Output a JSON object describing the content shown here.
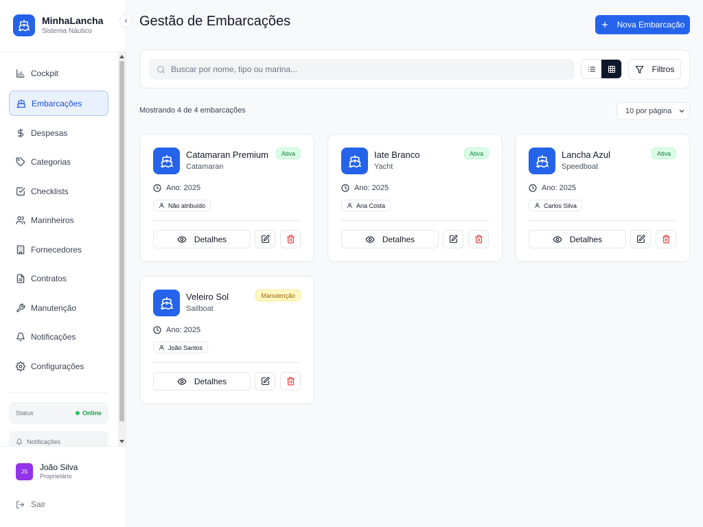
{
  "brand": {
    "name": "MinhaLancha",
    "subtitle": "Sistema Náutico"
  },
  "sidebar": {
    "items": [
      {
        "label": "Cockpit",
        "icon": "bar-chart-icon",
        "active": false
      },
      {
        "label": "Embarcações",
        "icon": "ship-icon",
        "active": true
      },
      {
        "label": "Despesas",
        "icon": "dollar-icon",
        "active": false
      },
      {
        "label": "Categorias",
        "icon": "tag-icon",
        "active": false
      },
      {
        "label": "Checklists",
        "icon": "checkbox-icon",
        "active": false
      },
      {
        "label": "Marinheiros",
        "icon": "users-icon",
        "active": false
      },
      {
        "label": "Fornecedores",
        "icon": "building-icon",
        "active": false
      },
      {
        "label": "Contratos",
        "icon": "file-icon",
        "active": false
      },
      {
        "label": "Manutenção",
        "icon": "wrench-icon",
        "active": false
      },
      {
        "label": "Notificações",
        "icon": "bell-icon",
        "active": false
      },
      {
        "label": "Configurações",
        "icon": "gear-icon",
        "active": false
      }
    ],
    "status": {
      "label": "Status",
      "value": "Online"
    },
    "notifications_label": "Notificações"
  },
  "user": {
    "initials": "JS",
    "name": "João Silva",
    "role": "Proprietário"
  },
  "logout_label": "Sair",
  "header": {
    "title": "Gestão de Embarcações",
    "new_button": "Nova Embarcação"
  },
  "search": {
    "placeholder": "Buscar por nome, tipo ou marina...",
    "value": ""
  },
  "filters_label": "Filtros",
  "view_mode": "grid",
  "results": {
    "summary": "Mostrando 4 de 4 embarcações",
    "per_page": "10 por página"
  },
  "boats": [
    {
      "name": "Catamaran Premium",
      "type": "Catamaran",
      "status": "Ativa",
      "year": "Ano: 2025",
      "owner": "Não atribuído"
    },
    {
      "name": "Iate Branco",
      "type": "Yacht",
      "status": "Ativa",
      "year": "Ano: 2025",
      "owner": "Ana Costa"
    },
    {
      "name": "Lancha Azul",
      "type": "Speedboat",
      "status": "Ativa",
      "year": "Ano: 2025",
      "owner": "Carlos Silva"
    },
    {
      "name": "Veleiro Sol",
      "type": "Sailboat",
      "status": "Manutenção",
      "year": "Ano: 2025",
      "owner": "João Santos"
    }
  ],
  "details_label": "Detalhes",
  "colors": {
    "primary": "#2563eb",
    "active_status": "#15803d",
    "maintenance_status": "#a16207",
    "danger": "#dc2626",
    "avatar": "#9333ea"
  }
}
